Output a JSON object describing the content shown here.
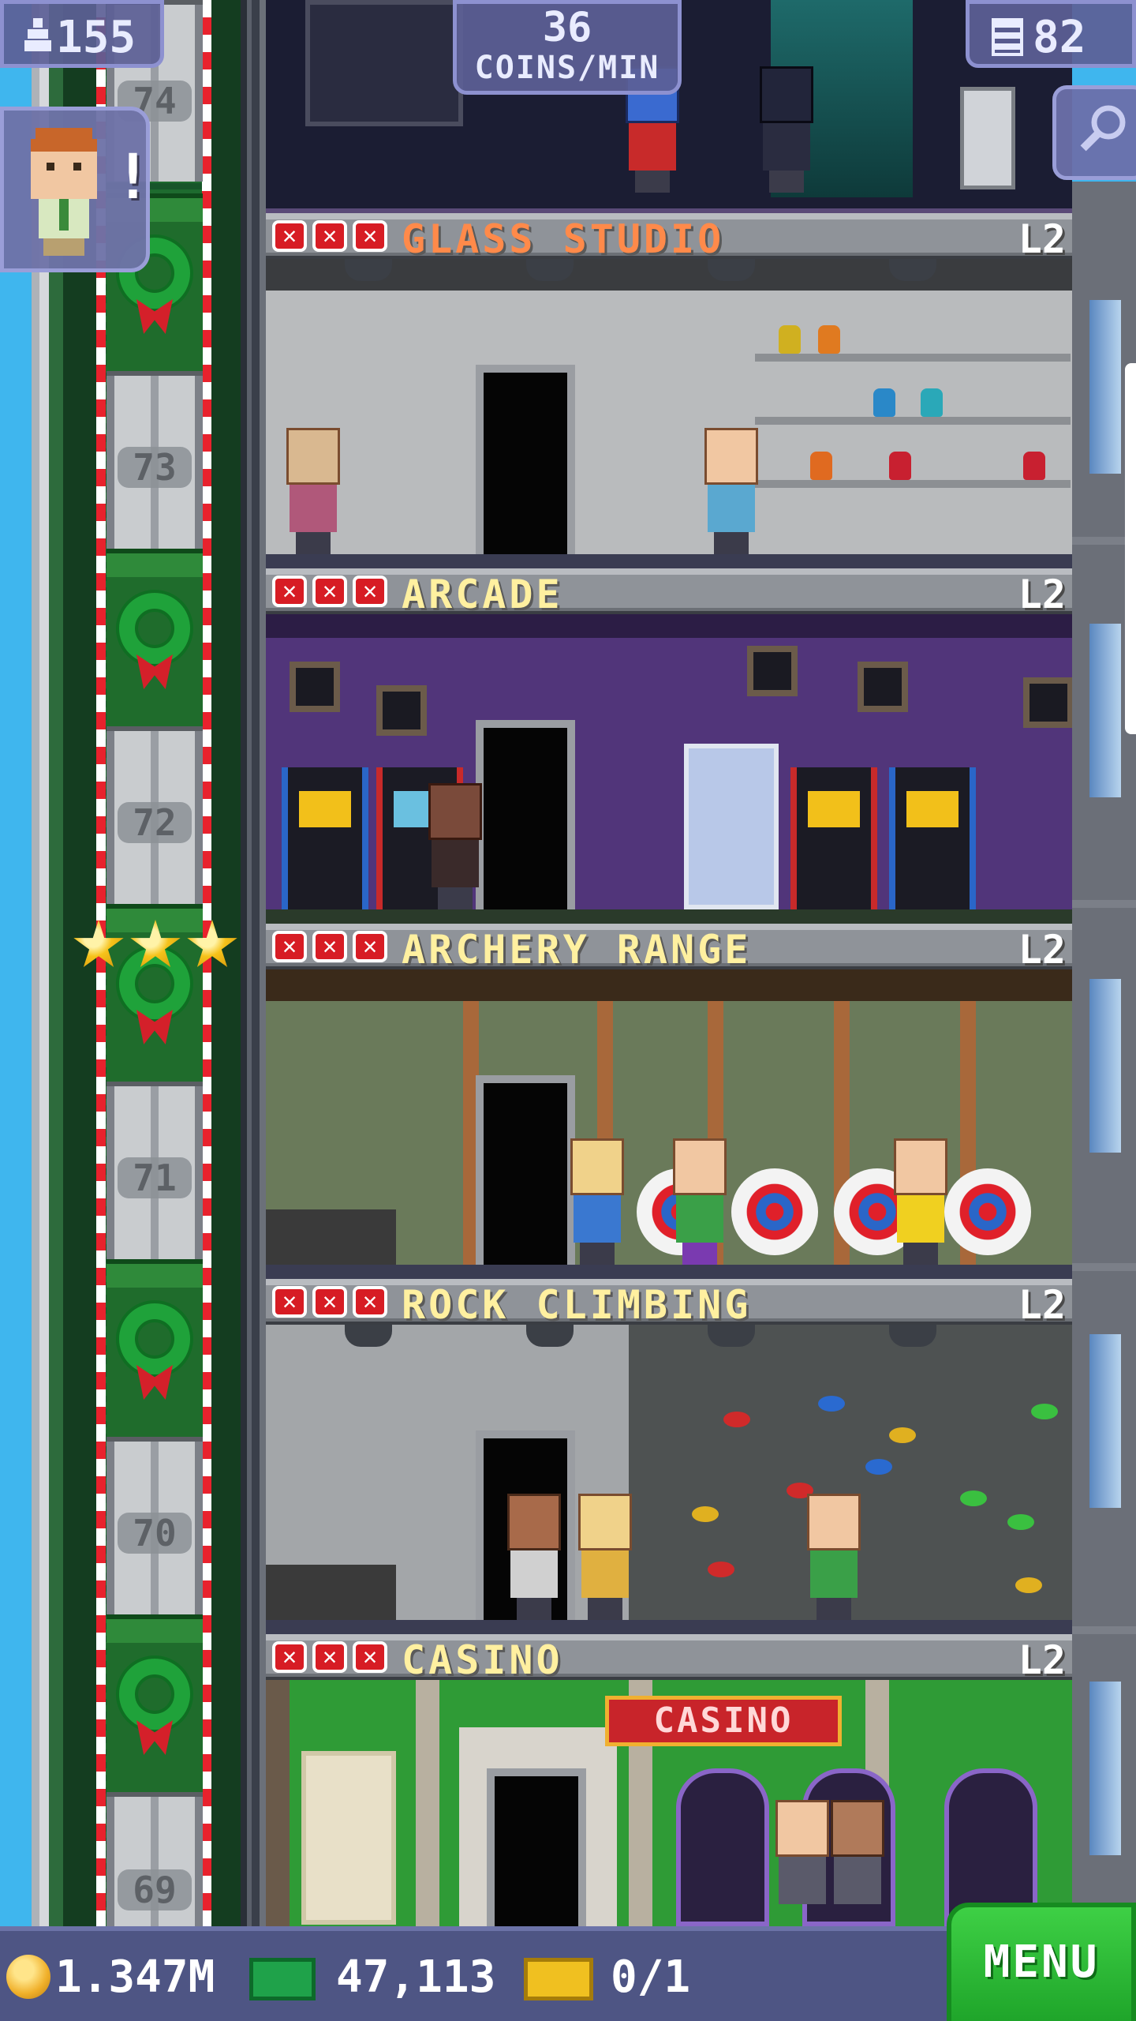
{
  "hud": {
    "population": "155",
    "income_value": "36",
    "income_unit": "COINS/MIN",
    "floors": "82"
  },
  "alert": {
    "mark": "!"
  },
  "elevator": {
    "floor_numbers": [
      "74",
      "73",
      "72",
      "71",
      "70",
      "69"
    ]
  },
  "floors": [
    {
      "name": "GLASS STUDIO",
      "level": "L2",
      "name_color": "#ff8a4a"
    },
    {
      "name": "ARCADE",
      "level": "L2",
      "name_color": "#fff0a0"
    },
    {
      "name": "ARCHERY RANGE",
      "level": "L2",
      "name_color": "#fff0a0"
    },
    {
      "name": "ROCK CLIMBING",
      "level": "L2",
      "name_color": "#fff0a0"
    },
    {
      "name": "CASINO",
      "level": "L2",
      "name_color": "#fff0a0"
    }
  ],
  "casino_sign": "CASINO",
  "bottom_bar": {
    "coins": "1.347M",
    "bux": "47,113",
    "tickets": "0/1",
    "menu_label": "MENU"
  },
  "icons": {
    "population": "person-up-icon",
    "floors": "building-icon",
    "search": "magnifier-icon",
    "coins": "coin-icon",
    "bux": "bux-icon",
    "tickets": "golden-ticket-icon"
  },
  "colors": {
    "sky": "#3fb6ee",
    "hud_panel": "#5c6096",
    "menu_green": "#2fc03a",
    "x_mark_red": "#d71c24"
  }
}
